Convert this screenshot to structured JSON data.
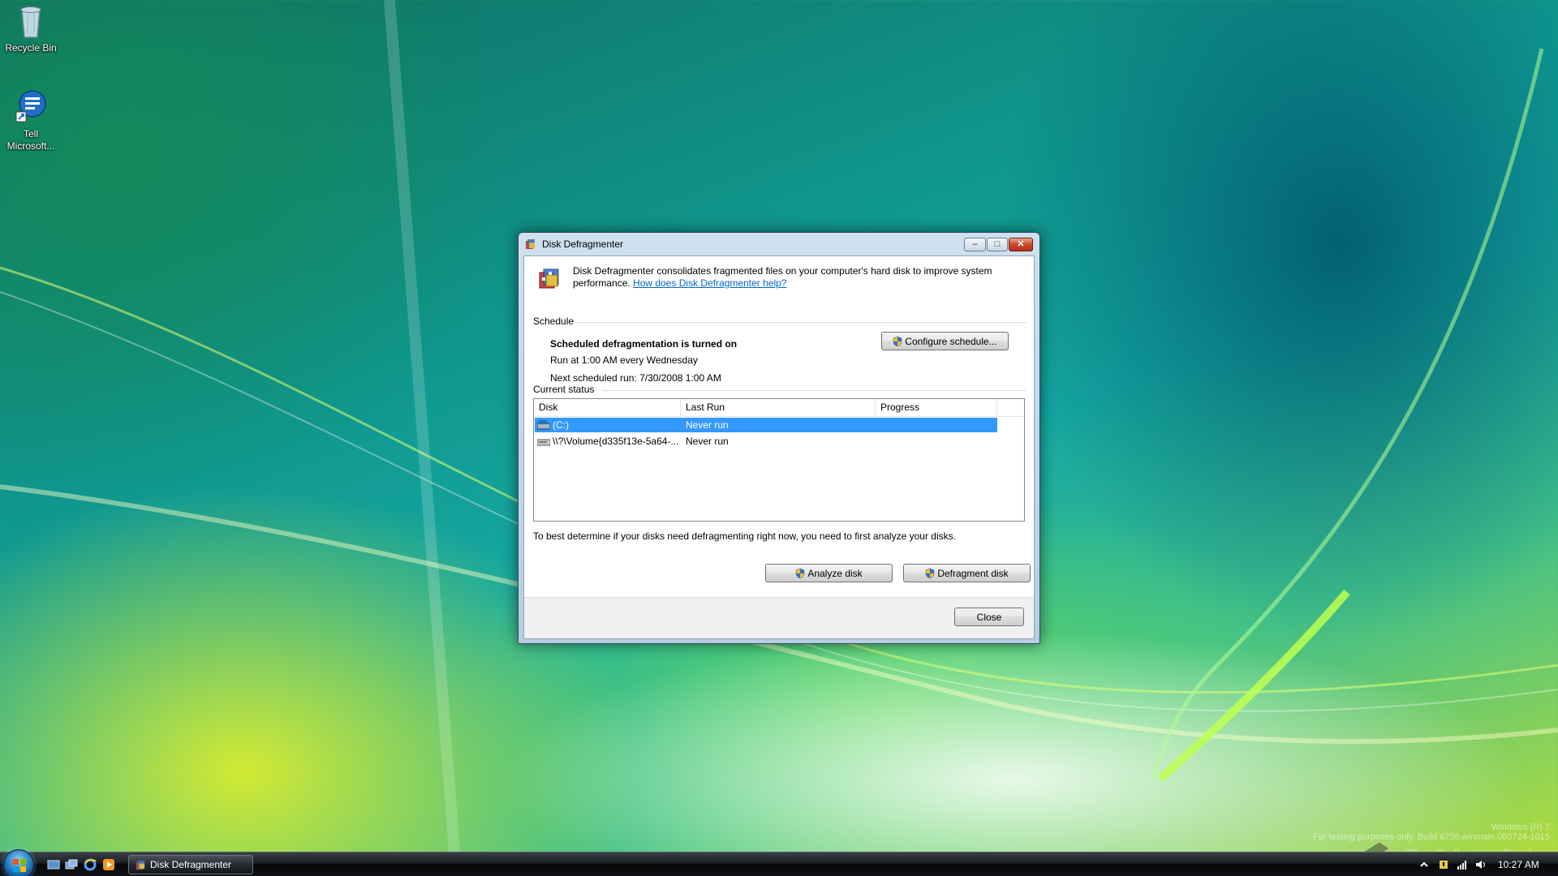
{
  "desktop": {
    "icons": [
      {
        "label": "Recycle Bin",
        "icon": "recycle-bin-icon"
      },
      {
        "label": "Tell Microsoft...",
        "icon": "tell-microsoft-icon"
      }
    ],
    "watermark": {
      "line1": "Windows (R) 7",
      "line2": "For testing purposes only. Build 6756.winmain.080724-1015",
      "brand": "The Collection Book"
    }
  },
  "window": {
    "title": "Disk Defragmenter",
    "intro": "Disk Defragmenter consolidates fragmented files on your computer's hard disk to improve system performance.",
    "help_link": "How does Disk Defragmenter help?",
    "schedule": {
      "heading": "Schedule",
      "status": "Scheduled defragmentation is turned on",
      "run_at": "Run at 1:00 AM every Wednesday",
      "next_run": "Next scheduled run: 7/30/2008 1:00 AM",
      "configure_button": "Configure schedule..."
    },
    "current_status": {
      "heading": "Current status",
      "columns": [
        "Disk",
        "Last Run",
        "Progress"
      ],
      "rows": [
        {
          "disk": "(C:)",
          "last_run": "Never run",
          "progress": "",
          "selected": true
        },
        {
          "disk": "\\\\?\\Volume{d335f13e-5a64-...",
          "last_run": "Never run",
          "progress": "",
          "selected": false
        }
      ]
    },
    "hint": "To best determine if your disks need defragmenting right now, you need to first analyze your disks.",
    "analyze_button": "Analyze disk",
    "defragment_button": "Defragment disk",
    "close_button": "Close",
    "caption": {
      "minimize": "–",
      "maximize": "□",
      "close": "✕"
    }
  },
  "taskbar": {
    "task_button": "Disk Defragmenter",
    "clock": "10:27 AM"
  },
  "colors": {
    "selection": "#3399ff",
    "link": "#0066cc",
    "close_button": "#c84a2f"
  }
}
